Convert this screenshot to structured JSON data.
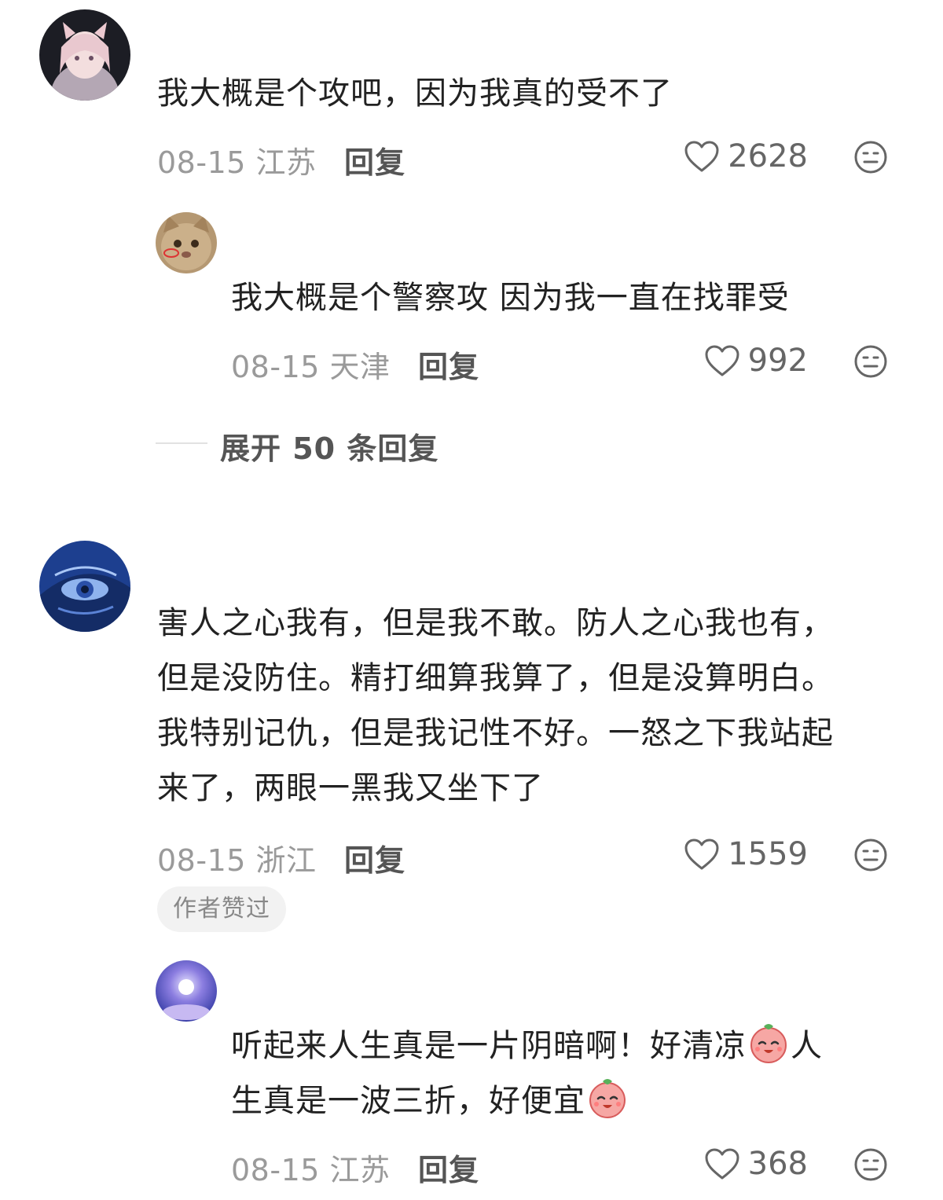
{
  "comments": [
    {
      "text": "我大概是个攻吧，因为我真的受不了",
      "date": "08-15",
      "location": "江苏",
      "reply_label": "回复",
      "likes": "2628",
      "replies": [
        {
          "text": "我大概是个警察攻 因为我一直在找罪受",
          "date": "08-15",
          "location": "天津",
          "reply_label": "回复",
          "likes": "992"
        }
      ],
      "expand_label": "展开 50 条回复"
    },
    {
      "text_lines": [
        "害人之心我有，但是我不敢。防人之心我也有，",
        "但是没防住。精打细算我算了，但是没算明白。",
        "我特别记仇，但是我记性不好。一怒之下我站起",
        "来了，两眼一黑我又坐下了"
      ],
      "date": "08-15",
      "location": "浙江",
      "reply_label": "回复",
      "likes": "1559",
      "badge": "作者赞过",
      "replies": [
        {
          "text_part1": "听起来人生真是一片阴暗啊！好清凉",
          "text_part2": "人",
          "text_part3": "生真是一波三折，好便宜",
          "date": "08-15",
          "location": "江苏",
          "reply_label": "回复",
          "likes": "368"
        }
      ]
    }
  ],
  "icons": {
    "like": "heart-outline-icon",
    "react": "neutral-face-icon",
    "emoji": "peach-smile-emoji"
  },
  "colors": {
    "text": "#222222",
    "meta": "#9a9a9a",
    "reply": "#555555",
    "badge_bg": "#f2f2f2"
  }
}
